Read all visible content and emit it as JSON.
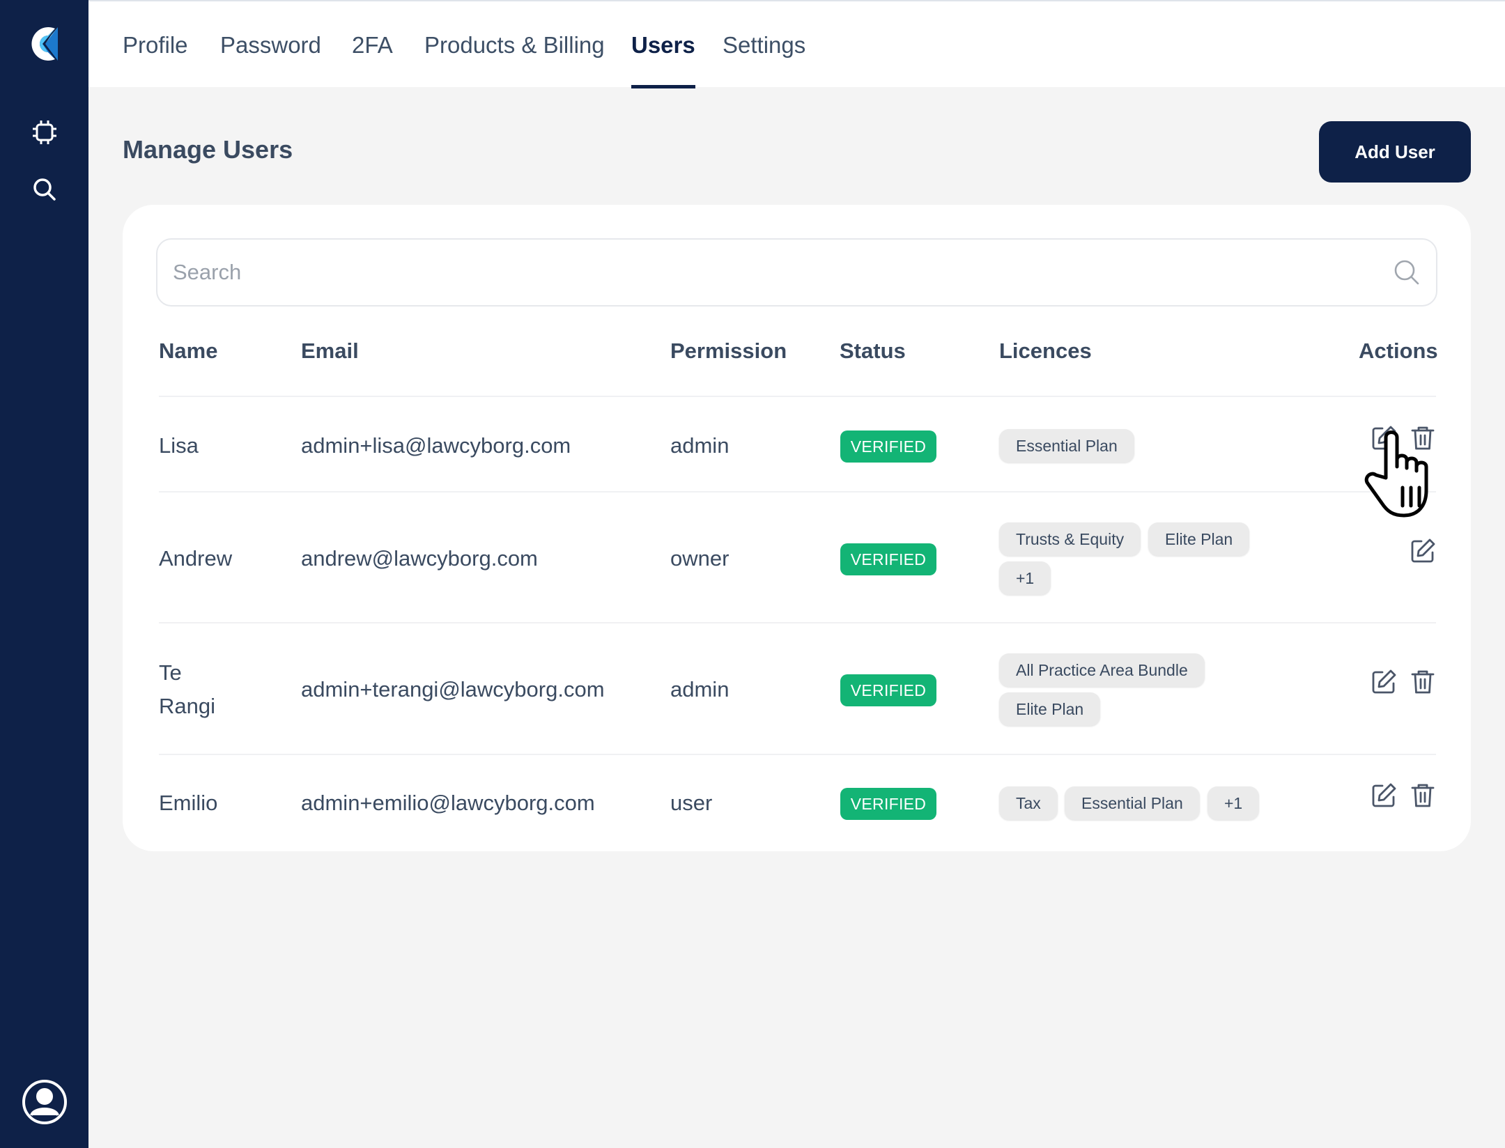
{
  "tabs": [
    {
      "label": "Profile"
    },
    {
      "label": "Password"
    },
    {
      "label": "2FA"
    },
    {
      "label": "Products & Billing"
    },
    {
      "label": "Users",
      "active": true
    },
    {
      "label": "Settings"
    }
  ],
  "page": {
    "title": "Manage Users",
    "add_user_label": "Add User"
  },
  "search": {
    "placeholder": "Search"
  },
  "table": {
    "headers": {
      "name": "Name",
      "email": "Email",
      "permission": "Permission",
      "status": "Status",
      "licences": "Licences",
      "actions": "Actions"
    },
    "rows": [
      {
        "name_line1": "Lisa",
        "name_line2": "",
        "email": "admin+lisa@lawcyborg.com",
        "permission": "admin",
        "status": "VERIFIED",
        "licences": [
          "Essential Plan"
        ]
      },
      {
        "name_line1": "Andrew",
        "name_line2": "",
        "email": "andrew@lawcyborg.com",
        "permission": "owner",
        "status": "VERIFIED",
        "licences": [
          "Trusts & Equity",
          "Elite Plan",
          "+1"
        ]
      },
      {
        "name_line1": "Te",
        "name_line2": "Rangi",
        "email": "admin+terangi@lawcyborg.com",
        "permission": "admin",
        "status": "VERIFIED",
        "licences": [
          "All Practice Area Bundle",
          "Elite Plan"
        ]
      },
      {
        "name_line1": "Emilio",
        "name_line2": "",
        "email": "admin+emilio@lawcyborg.com",
        "permission": "user",
        "status": "VERIFIED",
        "licences": [
          "Tax",
          "Essential Plan",
          "+1"
        ]
      }
    ]
  },
  "colors": {
    "sidebar": "#0e2148",
    "primary": "#0e2148",
    "verified": "#13b475",
    "logo_light": "#4fc3f7",
    "logo_dark": "#1565c0"
  },
  "icons": {
    "logo": "app-logo-icon",
    "sidebar_1": "chip-icon",
    "sidebar_2": "search-icon",
    "account": "user-avatar-icon",
    "edit": "edit-icon",
    "delete": "trash-icon"
  }
}
